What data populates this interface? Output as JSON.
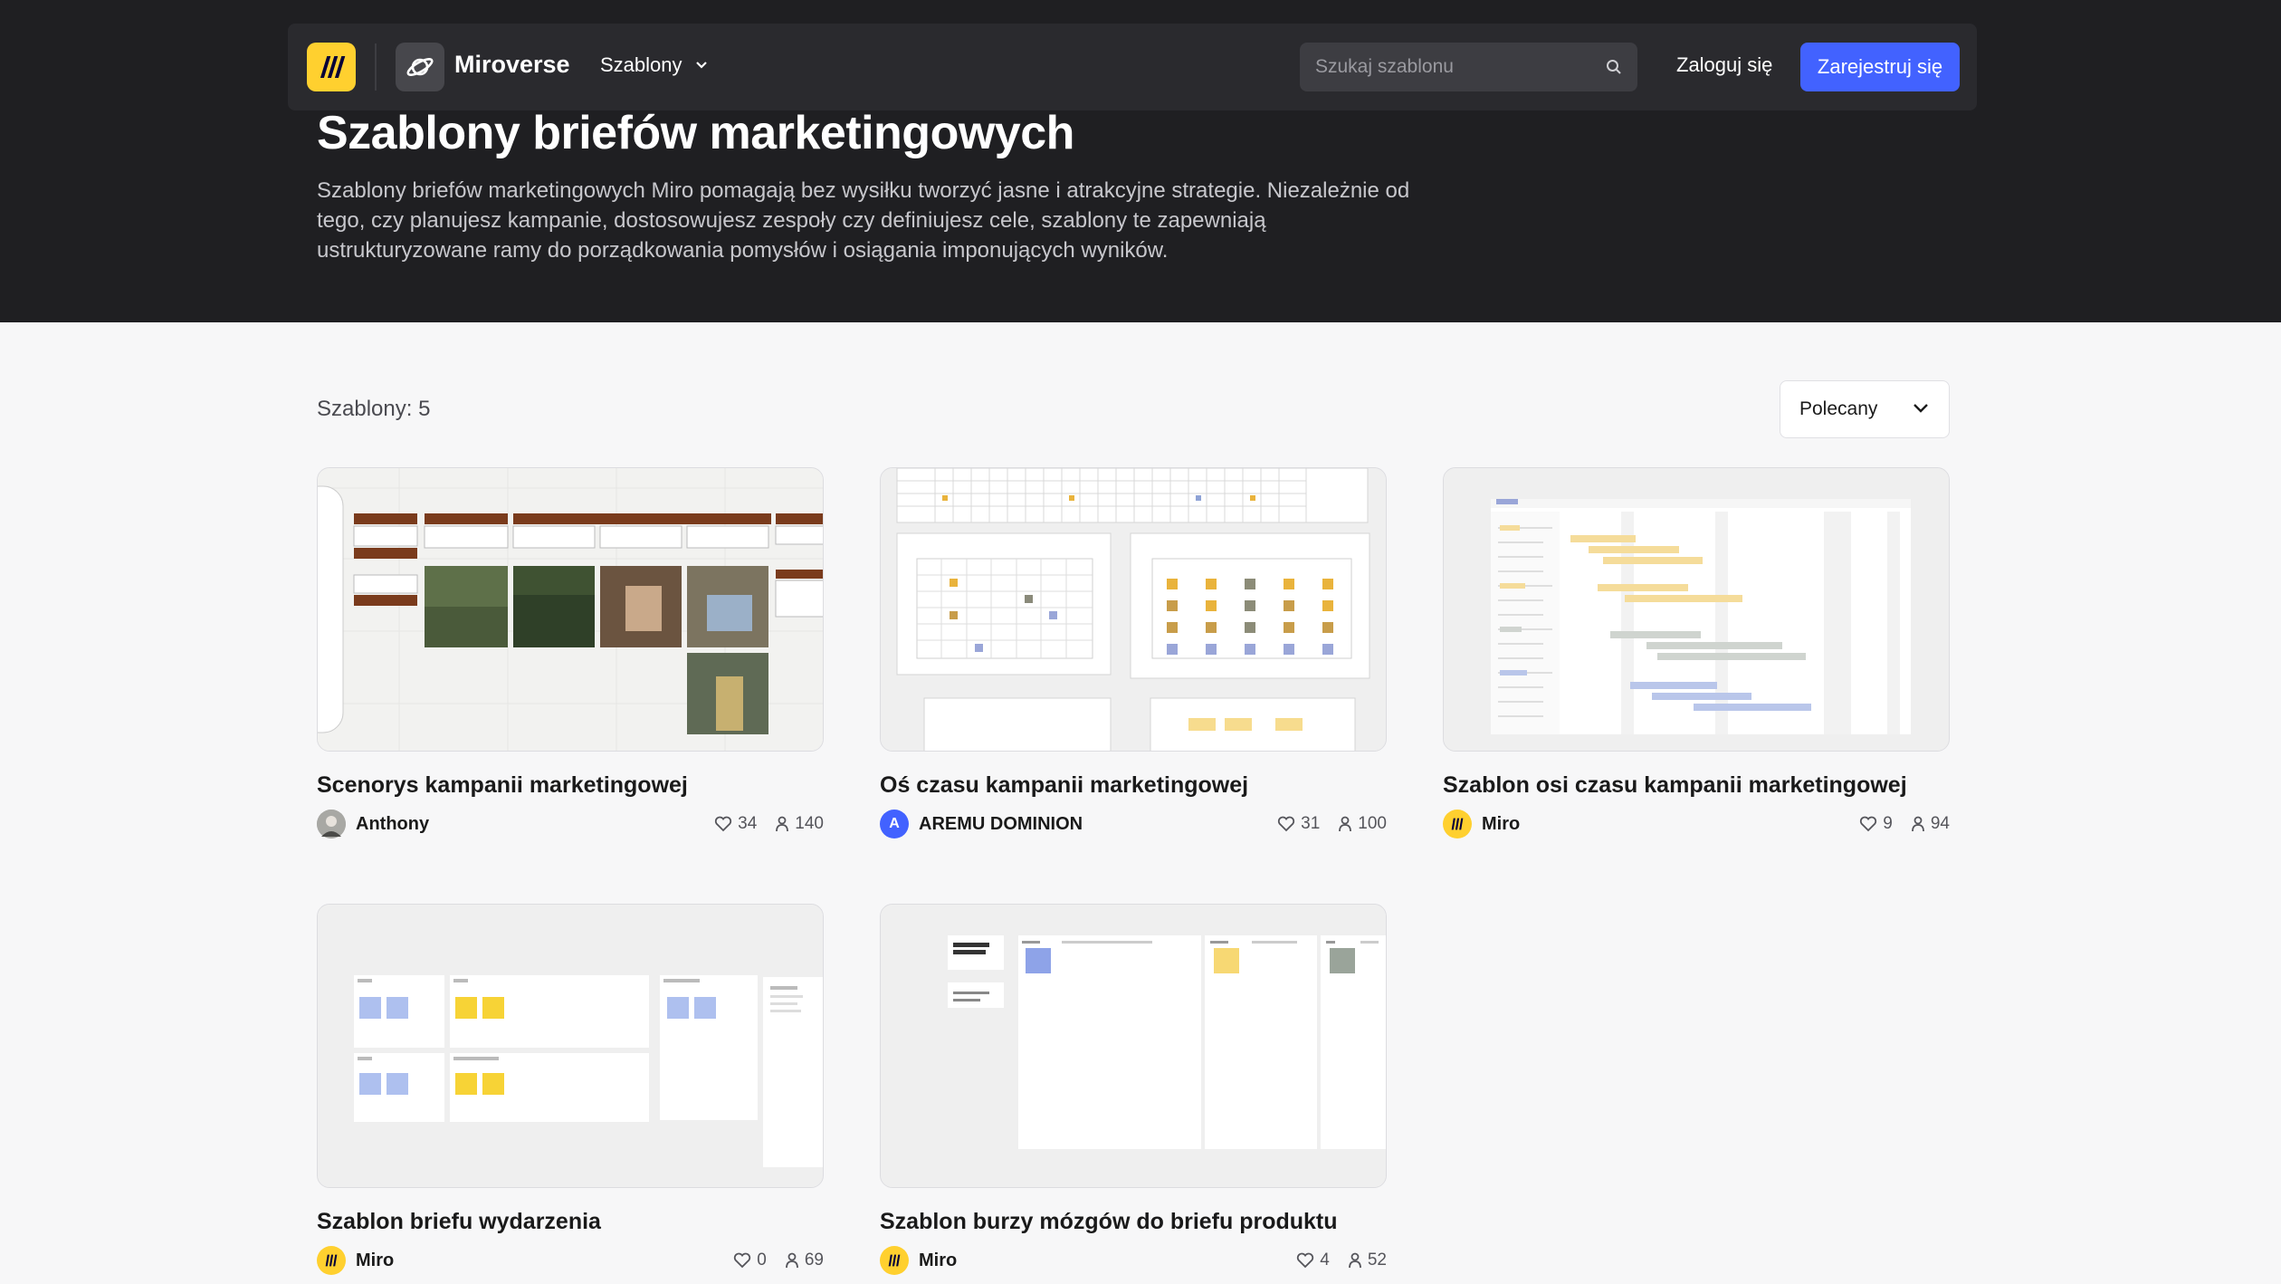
{
  "header": {
    "brand": "Miroverse",
    "nav_templates": "Szablony",
    "search_placeholder": "Szukaj szablonu",
    "login": "Zaloguj się",
    "signup": "Zarejestruj się"
  },
  "hero": {
    "title": "Szablony briefów marketingowych",
    "description": "Szablony briefów marketingowych Miro pomagają bez wysiłku tworzyć jasne i atrakcyjne strategie. Niezależnie od tego, czy planujesz kampanie, dostosowujesz zespoły czy definiujesz cele, szablony te zapewniają ustrukturyzowane ramy do porządkowania pomysłów i osiągania imponujących wyników."
  },
  "listing": {
    "count_label": "Szablony: 5",
    "sort_selected": "Polecany"
  },
  "cards": [
    {
      "title": "Scenorys kampanii marketingowej",
      "author": "Anthony",
      "likes": "34",
      "uses": "140",
      "avatar_type": "photo"
    },
    {
      "title": "Oś czasu kampanii marketingowej",
      "author": "AREMU DOMINION",
      "likes": "31",
      "uses": "100",
      "avatar_type": "letter",
      "avatar_letter": "A"
    },
    {
      "title": "Szablon osi czasu kampanii marketingowej",
      "author": "Miro",
      "likes": "9",
      "uses": "94",
      "avatar_type": "miro"
    },
    {
      "title": "Szablon briefu wydarzenia",
      "author": "Miro",
      "likes": "0",
      "uses": "69",
      "avatar_type": "miro"
    },
    {
      "title": "Szablon burzy mózgów do briefu produktu",
      "author": "Miro",
      "likes": "4",
      "uses": "52",
      "avatar_type": "miro"
    }
  ],
  "colors": {
    "hero_bg": "#1f1f22",
    "accent": "#4262ff",
    "miro_yellow": "#ffd02f"
  },
  "icons": [
    "miro-logo-icon",
    "planet-icon",
    "chevron-down-icon",
    "search-icon",
    "heart-icon",
    "user-icon"
  ]
}
